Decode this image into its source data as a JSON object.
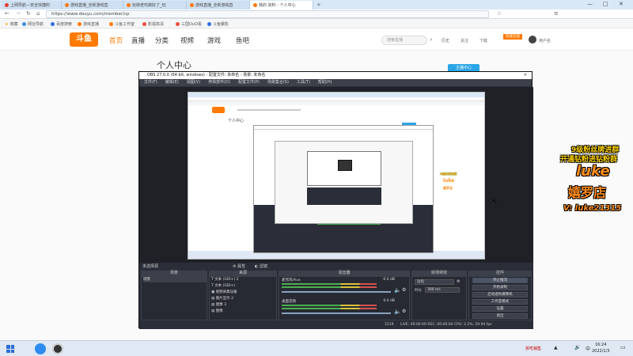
{
  "browser": {
    "tabs": [
      {
        "label": "上网导航—安全快捷的",
        "color": "#e0402f"
      },
      {
        "label": "游戏直播_全新游戏直",
        "color": "#ff7a00"
      },
      {
        "label": "玩转老鸡做好了_玩",
        "color": "#ff7a00"
      },
      {
        "label": "游戏直播_全新游戏直",
        "color": "#ff7a00"
      },
      {
        "label": "我的 资料 - 个人中心",
        "color": "#ff7a00"
      }
    ],
    "url": "https://www.douyu.com/member/cp",
    "bookmarks": [
      "收藏",
      "网址导航",
      "百度搜索",
      "游戏直播",
      "斗鱼工作室",
      "影视高清",
      "三国OuO看",
      "斗鱼聚影"
    ]
  },
  "site": {
    "logo_text": "斗鱼",
    "nav": [
      "首页",
      "直播",
      "分类",
      "视频",
      "游戏",
      "鱼吧"
    ],
    "search_placeholder": "搜索直播",
    "right_items": [
      "历史",
      "关注",
      "下载"
    ],
    "recharge": "快速充值",
    "username": "用户名"
  },
  "page": {
    "title": "个人中心",
    "anchor_btn": "主播中心"
  },
  "obs": {
    "title": "OBS 27.0.0 (64-bit, windows) - 配置文件: 未命名 - 场景: 未命名",
    "menu": [
      "文件(F)",
      "编辑(E)",
      "视图(V)",
      "停靠部件(D)",
      "配置文件(P)",
      "场景集合(S)",
      "工具(T)",
      "帮助(H)"
    ],
    "no_source": "未选择源",
    "props_btn": "属性",
    "filters_btn": "滤镜",
    "docks": {
      "scenes": "场景",
      "sources": "来源",
      "mixer": "混音器",
      "transitions": "转场特效",
      "controls": "控件"
    },
    "scene_list": [
      "场景"
    ],
    "sources_list": [
      "文本 (GDI+) 2",
      "文本 (GDI+)",
      "视频采集设备",
      "图片显示 2",
      "图像 3",
      "图像"
    ],
    "mixer": [
      {
        "name": "麦克风/Aux",
        "db": "-0.0 dB"
      },
      {
        "name": "桌面音频",
        "db": "0.0 dB"
      }
    ],
    "transition": {
      "value": "淡化",
      "duration_label": "时长",
      "duration": "300 ms"
    },
    "controls": [
      "停止推流",
      "开始录制",
      "启动虚拟摄像机",
      "工作室模式",
      "设置",
      "退出"
    ],
    "status": "LIVE: 00:00:00  REC: 00:00:00  CPU: 2.2%, 59.94 fps",
    "kbps": "1219"
  },
  "promo": {
    "line1": "9级粉丝牌进群",
    "line2": "开通钻粉进钻粉群",
    "brand1": "luke",
    "brand2": "嬉罗店",
    "wechat": "V: luke21315"
  },
  "taskbar": {
    "time": "16:24",
    "date": "2022/1/3",
    "lang": "中",
    "notification": "拆吃销售"
  }
}
